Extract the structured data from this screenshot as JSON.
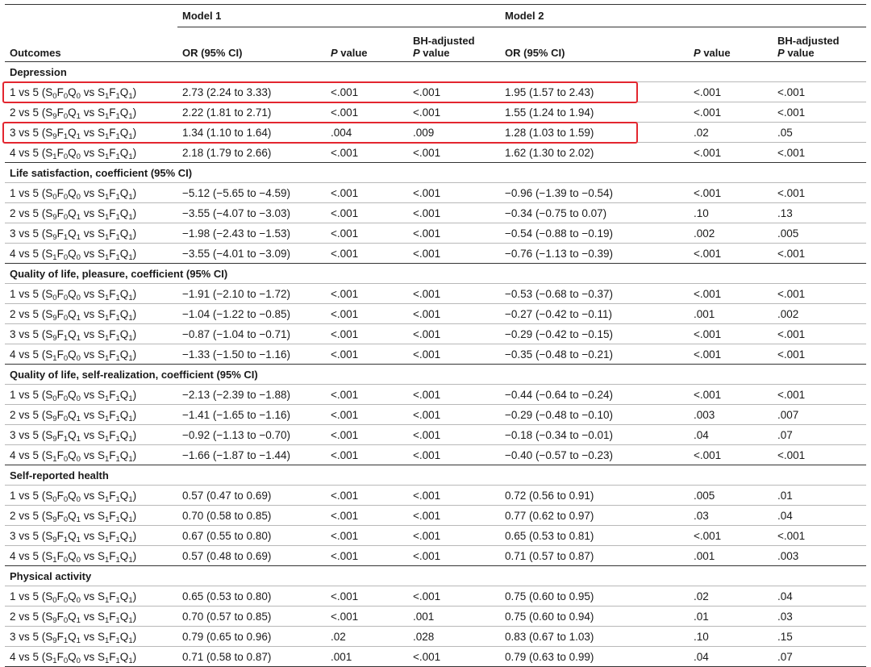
{
  "table": {
    "model_headers": [
      "Model 1",
      "Model 2"
    ],
    "columns": {
      "outcomes": "Outcomes",
      "or_ci": "OR (95% CI)",
      "p_italic": "P",
      "p_suffix": " value",
      "bh_line1": "BH-adjusted",
      "bh_italic": "P",
      "bh_suffix": " value"
    },
    "sections": [
      {
        "title": "Depression",
        "rows": [
          {
            "comp": [
              "1 vs 5 (S",
              "0",
              "F",
              "0",
              "Q",
              "0",
              " vs S",
              "1",
              "F",
              "1",
              "Q",
              "1",
              ")"
            ],
            "m1": "2.73 (2.24 to 3.33)",
            "p1": "<.001",
            "bh1": "<.001",
            "m2": "1.95 (1.57 to 2.43)",
            "p2": "<.001",
            "bh2": "<.001"
          },
          {
            "comp": [
              "2 vs 5 (S",
              "9",
              "F",
              "0",
              "Q",
              "1",
              " vs S",
              "1",
              "F",
              "1",
              "Q",
              "1",
              ")"
            ],
            "m1": "2.22 (1.81 to 2.71)",
            "p1": "<.001",
            "bh1": "<.001",
            "m2": "1.55 (1.24 to 1.94)",
            "p2": "<.001",
            "bh2": "<.001"
          },
          {
            "comp": [
              "3 vs 5 (S",
              "9",
              "F",
              "1",
              "Q",
              "1",
              " vs S",
              "1",
              "F",
              "1",
              "Q",
              "1",
              ")"
            ],
            "m1": "1.34 (1.10 to 1.64)",
            "p1": ".004",
            "bh1": ".009",
            "m2": "1.28 (1.03 to 1.59)",
            "p2": ".02",
            "bh2": ".05"
          },
          {
            "comp": [
              "4 vs 5 (S",
              "1",
              "F",
              "0",
              "Q",
              "0",
              " vs S",
              "1",
              "F",
              "1",
              "Q",
              "1",
              ")"
            ],
            "m1": "2.18 (1.79 to 2.66)",
            "p1": "<.001",
            "bh1": "<.001",
            "m2": "1.62 (1.30 to 2.02)",
            "p2": "<.001",
            "bh2": "<.001"
          }
        ]
      },
      {
        "title": "Life satisfaction, coefficient (95% CI)",
        "rows": [
          {
            "comp": [
              "1 vs 5 (S",
              "0",
              "F",
              "0",
              "Q",
              "0",
              " vs S",
              "1",
              "F",
              "1",
              "Q",
              "1",
              ")"
            ],
            "m1": "−5.12 (−5.65 to −4.59)",
            "p1": "<.001",
            "bh1": "<.001",
            "m2": "−0.96 (−1.39 to −0.54)",
            "p2": "<.001",
            "bh2": "<.001"
          },
          {
            "comp": [
              "2 vs 5 (S",
              "9",
              "F",
              "0",
              "Q",
              "1",
              " vs S",
              "1",
              "F",
              "1",
              "Q",
              "1",
              ")"
            ],
            "m1": "−3.55 (−4.07 to −3.03)",
            "p1": "<.001",
            "bh1": "<.001",
            "m2": "−0.34 (−0.75 to 0.07)",
            "p2": ".10",
            "bh2": ".13"
          },
          {
            "comp": [
              "3 vs 5 (S",
              "9",
              "F",
              "1",
              "Q",
              "1",
              " vs S",
              "1",
              "F",
              "1",
              "Q",
              "1",
              ")"
            ],
            "m1": "−1.98 (−2.43 to −1.53)",
            "p1": "<.001",
            "bh1": "<.001",
            "m2": "−0.54 (−0.88 to −0.19)",
            "p2": ".002",
            "bh2": ".005"
          },
          {
            "comp": [
              "4 vs 5 (S",
              "1",
              "F",
              "0",
              "Q",
              "0",
              " vs S",
              "1",
              "F",
              "1",
              "Q",
              "1",
              ")"
            ],
            "m1": "−3.55 (−4.01 to −3.09)",
            "p1": "<.001",
            "bh1": "<.001",
            "m2": "−0.76 (−1.13 to −0.39)",
            "p2": "<.001",
            "bh2": "<.001"
          }
        ]
      },
      {
        "title": "Quality of life, pleasure, coefficient (95% CI)",
        "rows": [
          {
            "comp": [
              "1 vs 5 (S",
              "0",
              "F",
              "0",
              "Q",
              "0",
              " vs S",
              "1",
              "F",
              "1",
              "Q",
              "1",
              ")"
            ],
            "m1": "−1.91 (−2.10 to −1.72)",
            "p1": "<.001",
            "bh1": "<.001",
            "m2": "−0.53 (−0.68 to −0.37)",
            "p2": "<.001",
            "bh2": "<.001"
          },
          {
            "comp": [
              "2 vs 5 (S",
              "9",
              "F",
              "0",
              "Q",
              "1",
              " vs S",
              "1",
              "F",
              "1",
              "Q",
              "1",
              ")"
            ],
            "m1": "−1.04 (−1.22 to −0.85)",
            "p1": "<.001",
            "bh1": "<.001",
            "m2": "−0.27 (−0.42 to −0.11)",
            "p2": ".001",
            "bh2": ".002"
          },
          {
            "comp": [
              "3 vs 5 (S",
              "9",
              "F",
              "1",
              "Q",
              "1",
              " vs S",
              "1",
              "F",
              "1",
              "Q",
              "1",
              ")"
            ],
            "m1": "−0.87 (−1.04 to −0.71)",
            "p1": "<.001",
            "bh1": "<.001",
            "m2": "−0.29 (−0.42 to −0.15)",
            "p2": "<.001",
            "bh2": "<.001"
          },
          {
            "comp": [
              "4 vs 5 (S",
              "1",
              "F",
              "0",
              "Q",
              "0",
              " vs S",
              "1",
              "F",
              "1",
              "Q",
              "1",
              ")"
            ],
            "m1": "−1.33 (−1.50 to −1.16)",
            "p1": "<.001",
            "bh1": "<.001",
            "m2": "−0.35 (−0.48 to −0.21)",
            "p2": "<.001",
            "bh2": "<.001"
          }
        ]
      },
      {
        "title": "Quality of life, self-realization, coefficient (95% CI)",
        "rows": [
          {
            "comp": [
              "1 vs 5 (S",
              "0",
              "F",
              "0",
              "Q",
              "0",
              " vs S",
              "1",
              "F",
              "1",
              "Q",
              "1",
              ")"
            ],
            "m1": "−2.13 (−2.39 to −1.88)",
            "p1": "<.001",
            "bh1": "<.001",
            "m2": "−0.44 (−0.64 to −0.24)",
            "p2": "<.001",
            "bh2": "<.001"
          },
          {
            "comp": [
              "2 vs 5 (S",
              "9",
              "F",
              "0",
              "Q",
              "1",
              " vs S",
              "1",
              "F",
              "1",
              "Q",
              "1",
              ")"
            ],
            "m1": "−1.41 (−1.65 to −1.16)",
            "p1": "<.001",
            "bh1": "<.001",
            "m2": "−0.29 (−0.48 to −0.10)",
            "p2": ".003",
            "bh2": ".007"
          },
          {
            "comp": [
              "3 vs 5 (S",
              "9",
              "F",
              "1",
              "Q",
              "1",
              " vs S",
              "1",
              "F",
              "1",
              "Q",
              "1",
              ")"
            ],
            "m1": "−0.92 (−1.13 to −0.70)",
            "p1": "<.001",
            "bh1": "<.001",
            "m2": "−0.18 (−0.34 to −0.01)",
            "p2": ".04",
            "bh2": ".07"
          },
          {
            "comp": [
              "4 vs 5 (S",
              "1",
              "F",
              "0",
              "Q",
              "0",
              " vs S",
              "1",
              "F",
              "1",
              "Q",
              "1",
              ")"
            ],
            "m1": "−1.66 (−1.87 to −1.44)",
            "p1": "<.001",
            "bh1": "<.001",
            "m2": "−0.40 (−0.57 to −0.23)",
            "p2": "<.001",
            "bh2": "<.001"
          }
        ]
      },
      {
        "title": "Self-reported health",
        "rows": [
          {
            "comp": [
              "1 vs 5 (S",
              "0",
              "F",
              "0",
              "Q",
              "0",
              " vs S",
              "1",
              "F",
              "1",
              "Q",
              "1",
              ")"
            ],
            "m1": "0.57 (0.47 to 0.69)",
            "p1": "<.001",
            "bh1": "<.001",
            "m2": "0.72 (0.56 to 0.91)",
            "p2": ".005",
            "bh2": ".01"
          },
          {
            "comp": [
              "2 vs 5 (S",
              "9",
              "F",
              "0",
              "Q",
              "1",
              " vs S",
              "1",
              "F",
              "1",
              "Q",
              "1",
              ")"
            ],
            "m1": "0.70 (0.58 to 0.85)",
            "p1": "<.001",
            "bh1": "<.001",
            "m2": "0.77 (0.62 to 0.97)",
            "p2": ".03",
            "bh2": ".04"
          },
          {
            "comp": [
              "3 vs 5 (S",
              "9",
              "F",
              "1",
              "Q",
              "1",
              " vs S",
              "1",
              "F",
              "1",
              "Q",
              "1",
              ")"
            ],
            "m1": "0.67 (0.55 to 0.80)",
            "p1": "<.001",
            "bh1": "<.001",
            "m2": "0.65 (0.53 to 0.81)",
            "p2": "<.001",
            "bh2": "<.001"
          },
          {
            "comp": [
              "4 vs 5 (S",
              "1",
              "F",
              "0",
              "Q",
              "0",
              " vs S",
              "1",
              "F",
              "1",
              "Q",
              "1",
              ")"
            ],
            "m1": "0.57 (0.48 to 0.69)",
            "p1": "<.001",
            "bh1": "<.001",
            "m2": "0.71 (0.57 to 0.87)",
            "p2": ".001",
            "bh2": ".003"
          }
        ]
      },
      {
        "title": "Physical activity",
        "rows": [
          {
            "comp": [
              "1 vs 5 (S",
              "0",
              "F",
              "0",
              "Q",
              "0",
              " vs S",
              "1",
              "F",
              "1",
              "Q",
              "1",
              ")"
            ],
            "m1": "0.65 (0.53 to 0.80)",
            "p1": "<.001",
            "bh1": "<.001",
            "m2": "0.75 (0.60 to 0.95)",
            "p2": ".02",
            "bh2": ".04"
          },
          {
            "comp": [
              "2 vs 5 (S",
              "9",
              "F",
              "0",
              "Q",
              "1",
              " vs S",
              "1",
              "F",
              "1",
              "Q",
              "1",
              ")"
            ],
            "m1": "0.70 (0.57 to 0.85)",
            "p1": "<.001",
            "bh1": ".001",
            "m2": "0.75 (0.60 to 0.94)",
            "p2": ".01",
            "bh2": ".03"
          },
          {
            "comp": [
              "3 vs 5 (S",
              "9",
              "F",
              "1",
              "Q",
              "1",
              " vs S",
              "1",
              "F",
              "1",
              "Q",
              "1",
              ")"
            ],
            "m1": "0.79 (0.65 to 0.96)",
            "p1": ".02",
            "bh1": ".028",
            "m2": "0.83 (0.67 to 1.03)",
            "p2": ".10",
            "bh2": ".15"
          },
          {
            "comp": [
              "4 vs 5 (S",
              "1",
              "F",
              "0",
              "Q",
              "0",
              " vs S",
              "1",
              "F",
              "1",
              "Q",
              "1",
              ")"
            ],
            "m1": "0.71 (0.58 to 0.87)",
            "p1": ".001",
            "bh1": "<.001",
            "m2": "0.79 (0.63 to 0.99)",
            "p2": ".04",
            "bh2": ".07"
          }
        ]
      }
    ]
  },
  "highlight_color": "#e3262f"
}
